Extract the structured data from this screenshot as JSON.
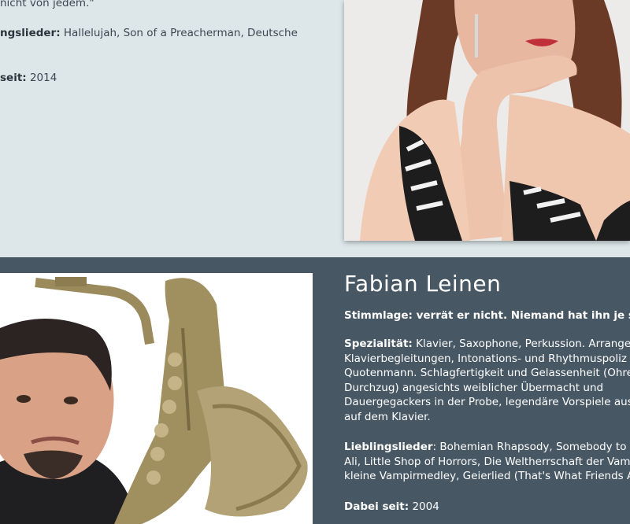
{
  "prev_member": {
    "quote_tail": "nicht von jedem.\"",
    "songs_label": "ngslieder:",
    "songs_value": "Hallelujah, Son of a Preacherman, Deutsche",
    "since_label": "seit:",
    "since_value": "2014"
  },
  "member": {
    "name": "Fabian Leinen",
    "voice": "Stimmlage: verrät er nicht. Niemand hat ihn je singe",
    "specialty_label": "Spezialität:",
    "specialty_lines": [
      "Klavier, Saxophone, Perkussion. Arrangem",
      "Klavierbegleitungen, Intonations- und Rhythmuspoliz",
      "Quotenmann. Schlagfertigkeit und Gelassenheit (Ohre",
      "Durchzug) angesichts weiblicher Übermacht und",
      "Dauergegackers in der Probe, legendäre Vorspiele aus",
      "auf dem Klavier."
    ],
    "songs_label": "Lieblingslieder",
    "songs_lines": [
      ": Bohemian Rhapsody, Somebody to Lo",
      "Ali, Little Shop of Horrors, Die Weltherrschaft der Vam",
      "kleine Vampirmedley, Geierlied (That's What Friends A"
    ],
    "since_label": "Dabei seit:",
    "since_value": "2004"
  }
}
